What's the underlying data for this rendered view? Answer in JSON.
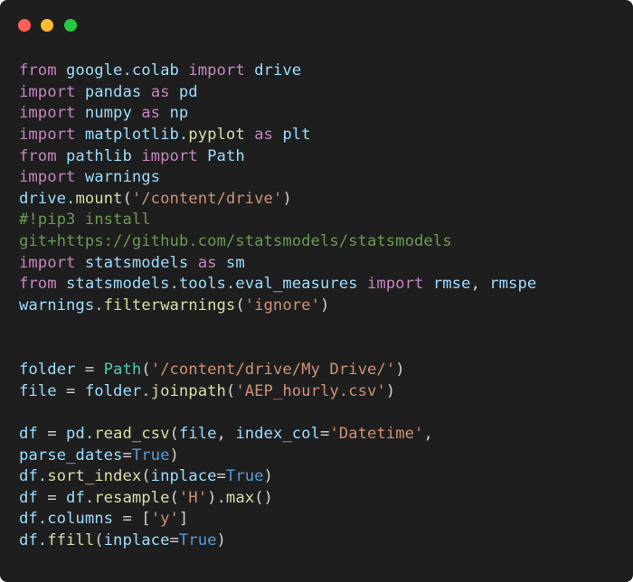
{
  "window": {
    "controls": [
      {
        "name": "close",
        "color": "#ff5f57"
      },
      {
        "name": "minimize",
        "color": "#febc2e"
      },
      {
        "name": "maximize",
        "color": "#28c840"
      }
    ]
  },
  "code": {
    "lines": [
      [
        {
          "t": "from",
          "c": "kw"
        },
        {
          "t": " ",
          "c": "plain"
        },
        {
          "t": "google.colab",
          "c": "id"
        },
        {
          "t": " ",
          "c": "plain"
        },
        {
          "t": "import",
          "c": "kw"
        },
        {
          "t": " ",
          "c": "plain"
        },
        {
          "t": "drive",
          "c": "id"
        }
      ],
      [
        {
          "t": "import",
          "c": "kw"
        },
        {
          "t": " ",
          "c": "plain"
        },
        {
          "t": "pandas",
          "c": "id"
        },
        {
          "t": " ",
          "c": "plain"
        },
        {
          "t": "as",
          "c": "kw"
        },
        {
          "t": " ",
          "c": "plain"
        },
        {
          "t": "pd",
          "c": "id"
        }
      ],
      [
        {
          "t": "import",
          "c": "kw"
        },
        {
          "t": " ",
          "c": "plain"
        },
        {
          "t": "numpy",
          "c": "id"
        },
        {
          "t": " ",
          "c": "plain"
        },
        {
          "t": "as",
          "c": "kw"
        },
        {
          "t": " ",
          "c": "plain"
        },
        {
          "t": "np",
          "c": "id"
        }
      ],
      [
        {
          "t": "import",
          "c": "kw"
        },
        {
          "t": " ",
          "c": "plain"
        },
        {
          "t": "matplotlib.",
          "c": "id"
        },
        {
          "t": "pyplot",
          "c": "fn"
        },
        {
          "t": " ",
          "c": "plain"
        },
        {
          "t": "as",
          "c": "kw"
        },
        {
          "t": " ",
          "c": "plain"
        },
        {
          "t": "plt",
          "c": "id"
        }
      ],
      [
        {
          "t": "from",
          "c": "kw"
        },
        {
          "t": " ",
          "c": "plain"
        },
        {
          "t": "pathlib",
          "c": "id"
        },
        {
          "t": " ",
          "c": "plain"
        },
        {
          "t": "import",
          "c": "kw"
        },
        {
          "t": " ",
          "c": "plain"
        },
        {
          "t": "Path",
          "c": "id"
        }
      ],
      [
        {
          "t": "import",
          "c": "kw"
        },
        {
          "t": " ",
          "c": "plain"
        },
        {
          "t": "warnings",
          "c": "id"
        }
      ],
      [
        {
          "t": "drive.",
          "c": "id"
        },
        {
          "t": "mount",
          "c": "fn"
        },
        {
          "t": "(",
          "c": "plain"
        },
        {
          "t": "'/content/drive'",
          "c": "str"
        },
        {
          "t": ")",
          "c": "plain"
        }
      ],
      [
        {
          "t": "#!pip3 install",
          "c": "comment"
        }
      ],
      [
        {
          "t": "git+https://github.com/statsmodels/statsmodels",
          "c": "comment"
        }
      ],
      [
        {
          "t": "import",
          "c": "kw"
        },
        {
          "t": " ",
          "c": "plain"
        },
        {
          "t": "statsmodels",
          "c": "id"
        },
        {
          "t": " ",
          "c": "plain"
        },
        {
          "t": "as",
          "c": "kw"
        },
        {
          "t": " ",
          "c": "plain"
        },
        {
          "t": "sm",
          "c": "id"
        }
      ],
      [
        {
          "t": "from",
          "c": "kw"
        },
        {
          "t": " ",
          "c": "plain"
        },
        {
          "t": "statsmodels.tools.eval_measures",
          "c": "id"
        },
        {
          "t": " ",
          "c": "plain"
        },
        {
          "t": "import",
          "c": "kw"
        },
        {
          "t": " ",
          "c": "plain"
        },
        {
          "t": "rmse",
          "c": "id"
        },
        {
          "t": ", ",
          "c": "plain"
        },
        {
          "t": "rmspe",
          "c": "id"
        }
      ],
      [
        {
          "t": "warnings.",
          "c": "id"
        },
        {
          "t": "filterwarnings",
          "c": "fn"
        },
        {
          "t": "(",
          "c": "plain"
        },
        {
          "t": "'ignore'",
          "c": "str"
        },
        {
          "t": ")",
          "c": "plain"
        }
      ],
      [],
      [],
      [
        {
          "t": "folder",
          "c": "id"
        },
        {
          "t": " = ",
          "c": "plain"
        },
        {
          "t": "Path",
          "c": "cls"
        },
        {
          "t": "(",
          "c": "plain"
        },
        {
          "t": "'/content/drive/My Drive/'",
          "c": "str"
        },
        {
          "t": ")",
          "c": "plain"
        }
      ],
      [
        {
          "t": "file",
          "c": "id"
        },
        {
          "t": " = ",
          "c": "plain"
        },
        {
          "t": "folder.",
          "c": "id"
        },
        {
          "t": "joinpath",
          "c": "fn"
        },
        {
          "t": "(",
          "c": "plain"
        },
        {
          "t": "'AEP_hourly.csv'",
          "c": "str"
        },
        {
          "t": ")",
          "c": "plain"
        }
      ],
      [],
      [
        {
          "t": "df",
          "c": "id"
        },
        {
          "t": " = ",
          "c": "plain"
        },
        {
          "t": "pd.",
          "c": "id"
        },
        {
          "t": "read_csv",
          "c": "fn"
        },
        {
          "t": "(",
          "c": "plain"
        },
        {
          "t": "file",
          "c": "id"
        },
        {
          "t": ", ",
          "c": "plain"
        },
        {
          "t": "index_col",
          "c": "id"
        },
        {
          "t": "=",
          "c": "plain"
        },
        {
          "t": "'Datetime'",
          "c": "str"
        },
        {
          "t": ",",
          "c": "plain"
        }
      ],
      [
        {
          "t": "parse_dates",
          "c": "id"
        },
        {
          "t": "=",
          "c": "plain"
        },
        {
          "t": "True",
          "c": "const"
        },
        {
          "t": ")",
          "c": "plain"
        }
      ],
      [
        {
          "t": "df.",
          "c": "id"
        },
        {
          "t": "sort_index",
          "c": "fn"
        },
        {
          "t": "(",
          "c": "plain"
        },
        {
          "t": "inplace",
          "c": "id"
        },
        {
          "t": "=",
          "c": "plain"
        },
        {
          "t": "True",
          "c": "const"
        },
        {
          "t": ")",
          "c": "plain"
        }
      ],
      [
        {
          "t": "df",
          "c": "id"
        },
        {
          "t": " = ",
          "c": "plain"
        },
        {
          "t": "df.",
          "c": "id"
        },
        {
          "t": "resample",
          "c": "fn"
        },
        {
          "t": "(",
          "c": "plain"
        },
        {
          "t": "'H'",
          "c": "str"
        },
        {
          "t": ").",
          "c": "plain"
        },
        {
          "t": "max",
          "c": "fn"
        },
        {
          "t": "()",
          "c": "plain"
        }
      ],
      [
        {
          "t": "df.",
          "c": "id"
        },
        {
          "t": "columns",
          "c": "id"
        },
        {
          "t": " = [",
          "c": "plain"
        },
        {
          "t": "'y'",
          "c": "str"
        },
        {
          "t": "]",
          "c": "plain"
        }
      ],
      [
        {
          "t": "df.",
          "c": "id"
        },
        {
          "t": "ffill",
          "c": "fn"
        },
        {
          "t": "(",
          "c": "plain"
        },
        {
          "t": "inplace",
          "c": "id"
        },
        {
          "t": "=",
          "c": "plain"
        },
        {
          "t": "True",
          "c": "const"
        },
        {
          "t": ")",
          "c": "plain"
        }
      ]
    ]
  }
}
